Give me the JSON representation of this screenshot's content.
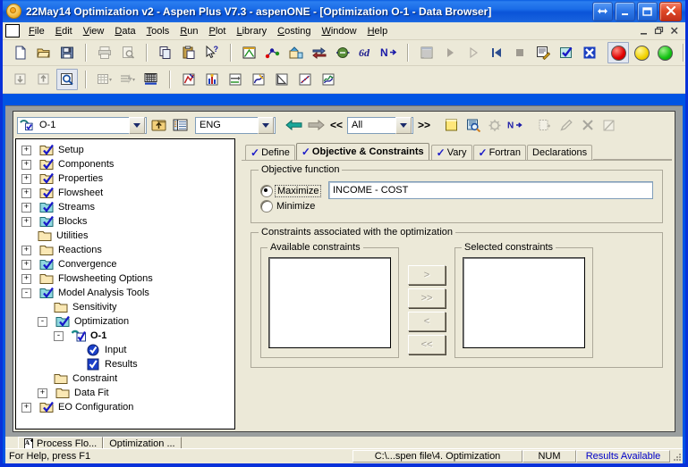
{
  "window": {
    "title": "22May14 Optimization v2 - Aspen Plus V7.3 - aspenONE  - [Optimization O-1 - Data Browser]",
    "buttons": {
      "restore_all": "restore-arrows-icon",
      "minimize": "_",
      "maximize": "maximize-icon",
      "close": "close-icon"
    },
    "mdi_buttons": {
      "minimize": "_",
      "restore": "restore-icon",
      "close": "close-icon"
    }
  },
  "menu": {
    "items": [
      {
        "label": "File",
        "accel": "F"
      },
      {
        "label": "Edit",
        "accel": "E"
      },
      {
        "label": "View",
        "accel": "V"
      },
      {
        "label": "Data",
        "accel": "D"
      },
      {
        "label": "Tools",
        "accel": "T"
      },
      {
        "label": "Run",
        "accel": "R"
      },
      {
        "label": "Plot",
        "accel": "P"
      },
      {
        "label": "Library",
        "accel": "L"
      },
      {
        "label": "Costing",
        "accel": "C"
      },
      {
        "label": "Window",
        "accel": "W"
      },
      {
        "label": "Help",
        "accel": "H"
      }
    ]
  },
  "toolbar": {
    "row1": [
      "new-icon",
      "open-icon",
      "save-icon",
      "print-icon",
      "print-preview-icon",
      "copy-icon",
      "paste-icon",
      "help-pointer-icon",
      "properties-icon",
      "components-icon",
      "flowsheet-icon",
      "streams-icon",
      "blocks-icon",
      "binary-analysis-icon",
      "next-icon",
      "data-browser-icon",
      "run-icon",
      "step-icon",
      "reinit-icon",
      "stop-icon",
      "control-panel-icon",
      "check-results-icon",
      "reconcile-icon",
      "status-red-icon",
      "status-yellow-icon",
      "status-green-icon",
      "annotate-icon"
    ],
    "row2": [
      "import-icon",
      "export-icon",
      "zoom-icon",
      "grid-icon",
      "lightning-icon",
      "globals-icon",
      "plot-wizard-icon",
      "histogram-icon",
      "merge-icon",
      "curve-icon",
      "slope-icon",
      "scatter-icon",
      "line-plot-icon"
    ]
  },
  "navbar": {
    "object": "O-1",
    "object_icon": "optimization-icon",
    "up_icon": "up-folder-icon",
    "tree_icon": "tree-view-icon",
    "units": "ENG",
    "back_icon": "back-arrow-icon",
    "forward_icon": "forward-arrow-icon",
    "prev_label": "<<",
    "filter": "All",
    "next_label": ">>",
    "note_icon": "notes-icon",
    "find_icon": "find-icon",
    "settings_icon": "settings-icon",
    "next_input_icon": "next-input-icon",
    "new_icon": "new-object-icon",
    "edit_icon": "rename-icon",
    "delete_icon": "delete-icon",
    "hide_icon": "hide-icon"
  },
  "tree": {
    "items": [
      {
        "label": "Setup",
        "depth": 0,
        "expander": "+",
        "icon": "folder-check-blue",
        "bold": false
      },
      {
        "label": "Components",
        "depth": 0,
        "expander": "+",
        "icon": "folder-check-blue",
        "bold": false
      },
      {
        "label": "Properties",
        "depth": 0,
        "expander": "+",
        "icon": "folder-check-blue",
        "bold": false
      },
      {
        "label": "Flowsheet",
        "depth": 0,
        "expander": "+",
        "icon": "folder-check-blue",
        "bold": false
      },
      {
        "label": "Streams",
        "depth": 0,
        "expander": "+",
        "icon": "folder-check-cyan",
        "bold": false
      },
      {
        "label": "Blocks",
        "depth": 0,
        "expander": "+",
        "icon": "folder-check-cyan",
        "bold": false
      },
      {
        "label": "Utilities",
        "depth": 0,
        "expander": "",
        "icon": "folder-plain",
        "bold": false
      },
      {
        "label": "Reactions",
        "depth": 0,
        "expander": "+",
        "icon": "folder-plain",
        "bold": false
      },
      {
        "label": "Convergence",
        "depth": 0,
        "expander": "+",
        "icon": "folder-check-cyan",
        "bold": false
      },
      {
        "label": "Flowsheeting Options",
        "depth": 0,
        "expander": "+",
        "icon": "folder-plain",
        "bold": false
      },
      {
        "label": "Model Analysis Tools",
        "depth": 0,
        "expander": "-",
        "icon": "folder-check-cyan",
        "bold": false
      },
      {
        "label": "Sensitivity",
        "depth": 1,
        "expander": "",
        "icon": "folder-plain",
        "bold": false
      },
      {
        "label": "Optimization",
        "depth": 1,
        "expander": "-",
        "icon": "folder-check-cyan",
        "bold": false
      },
      {
        "label": "O-1",
        "depth": 2,
        "expander": "-",
        "icon": "optimization-icon",
        "bold": true
      },
      {
        "label": "Input",
        "depth": 3,
        "expander": "",
        "icon": "circle-check-icon",
        "bold": false
      },
      {
        "label": "Results",
        "depth": 3,
        "expander": "",
        "icon": "square-check-icon",
        "bold": false
      },
      {
        "label": "Constraint",
        "depth": 1,
        "expander": "",
        "icon": "folder-plain",
        "bold": false
      },
      {
        "label": "Data Fit",
        "depth": 1,
        "expander": "+",
        "icon": "folder-plain",
        "bold": false
      },
      {
        "label": "EO Configuration",
        "depth": 0,
        "expander": "+",
        "icon": "folder-check-blue",
        "bold": false
      }
    ]
  },
  "tabs": [
    {
      "label": "Define",
      "check": "✓",
      "active": false
    },
    {
      "label": "Objective & Constraints",
      "check": "✓",
      "active": true
    },
    {
      "label": "Vary",
      "check": "✓",
      "active": false
    },
    {
      "label": "Fortran",
      "check": "✓",
      "active": false
    },
    {
      "label": "Declarations",
      "check": "",
      "active": false
    }
  ],
  "objective": {
    "group_title": "Objective function",
    "maximize_label": "Maximize",
    "minimize_label": "Minimize",
    "selected": "Maximize",
    "expression": "INCOME - COST"
  },
  "constraints": {
    "group_title": "Constraints associated with the optimization",
    "available_title": "Available constraints",
    "selected_title": "Selected constraints",
    "available_items": [],
    "selected_items": [],
    "buttons": [
      ">",
      ">>",
      "<",
      "<<"
    ]
  },
  "doc_tabs": [
    {
      "label": "Process Flo...",
      "icon": "flowsheet-doc-icon",
      "active": true
    },
    {
      "label": "Optimization ...",
      "icon": "",
      "active": false
    }
  ],
  "status": {
    "help": "For Help, press F1",
    "file": "C:\\...spen file\\4. Optimization",
    "num": "NUM",
    "results": "Results Available"
  },
  "colors": {
    "title_blue": "#0a54d8",
    "face": "#ece9d8",
    "results_blue": "#0000c8",
    "check_blue": "#1c1cc8",
    "status_red": "#e00000",
    "status_yellow": "#f2d200",
    "status_green": "#13c213"
  }
}
